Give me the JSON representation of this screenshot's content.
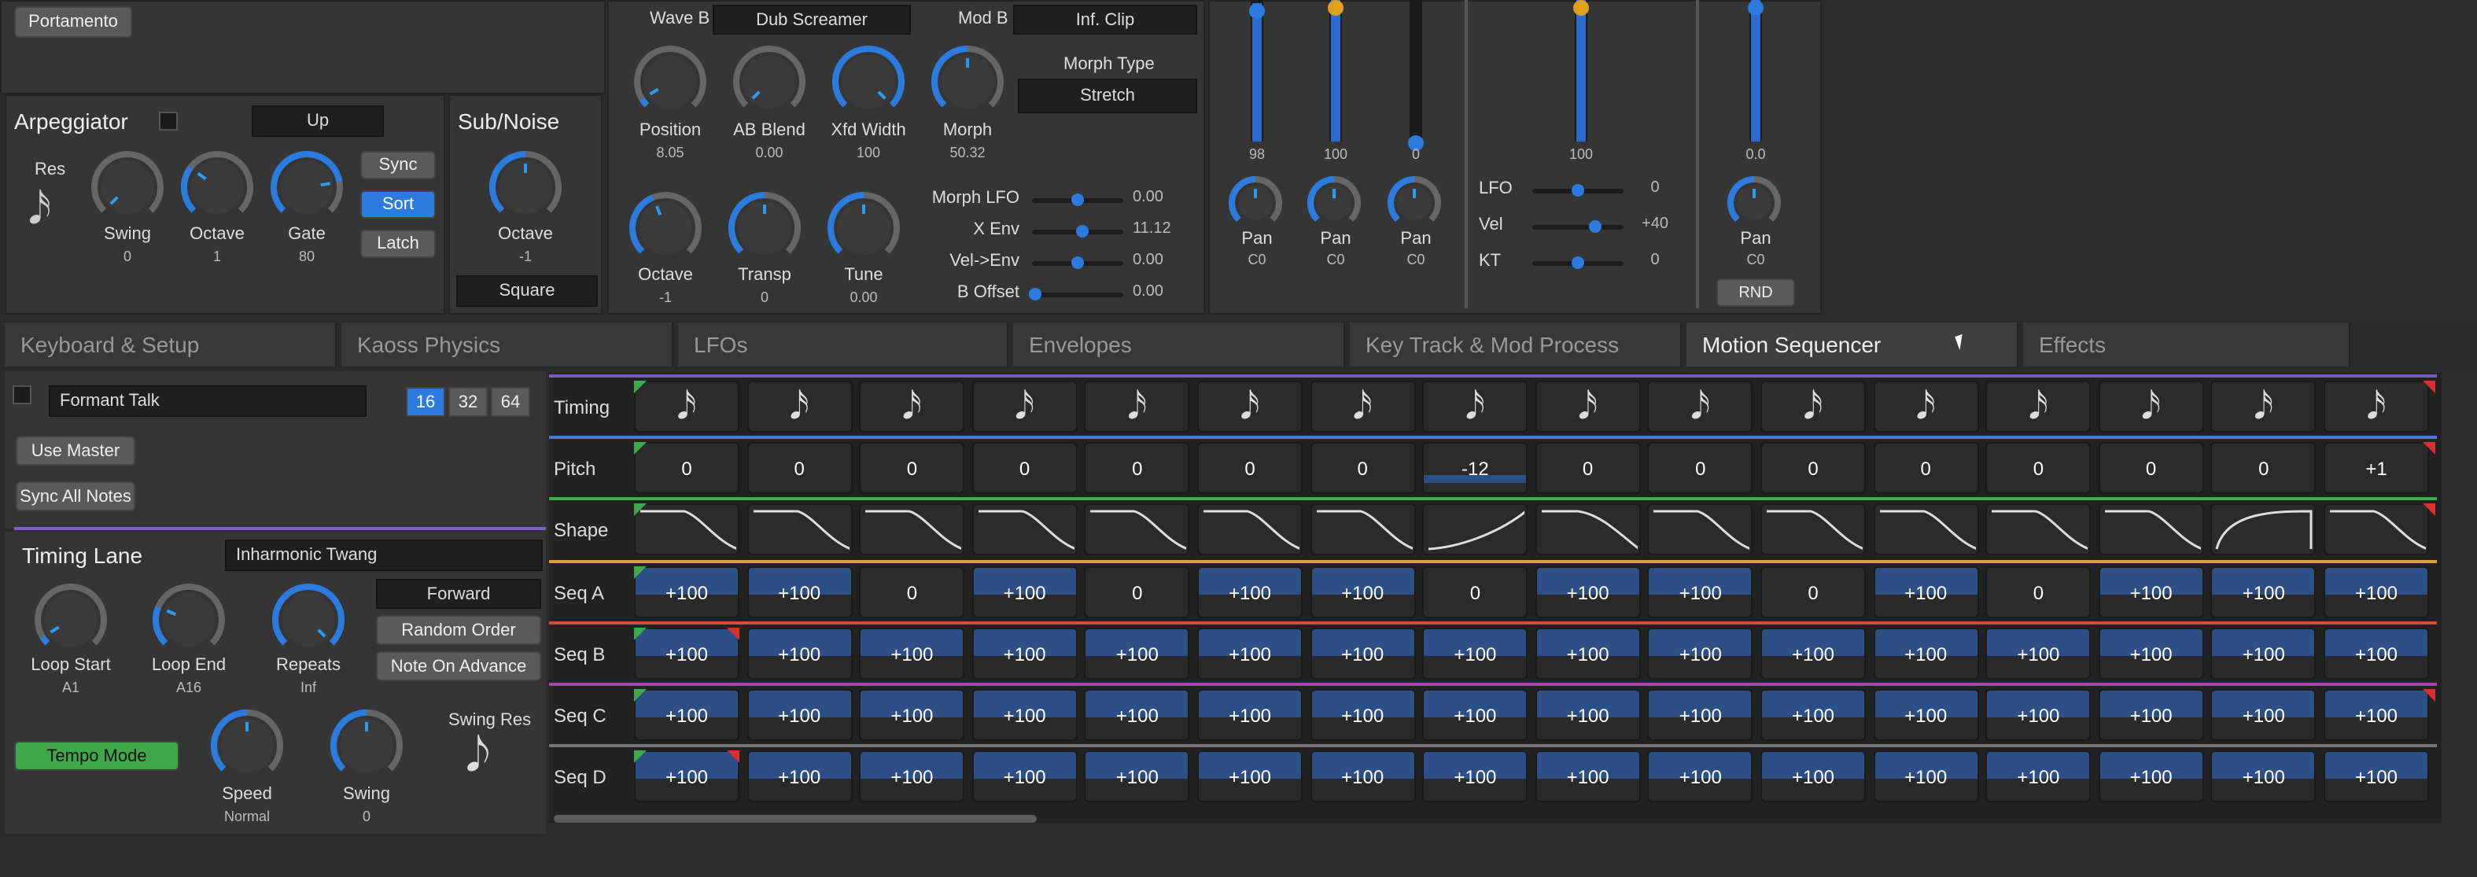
{
  "portamento": {
    "label": "Portamento"
  },
  "arp": {
    "title": "Arpeggiator",
    "mode": "Up",
    "res_label": "Res",
    "knobs": [
      {
        "label": "Swing",
        "value": "0",
        "level": 0.0
      },
      {
        "label": "Octave",
        "value": "1",
        "level": 0.3
      },
      {
        "label": "Gate",
        "value": "80",
        "level": 0.8
      }
    ],
    "buttons": [
      "Sync",
      "Sort",
      "Latch"
    ]
  },
  "subnoise": {
    "title": "Sub/Noise",
    "knob": {
      "label": "Octave",
      "value": "-1",
      "level": 0.5
    },
    "wave": "Square"
  },
  "osc": {
    "wave_b_label": "Wave B",
    "wave_b": "Dub Screamer",
    "mod_b_label": "Mod B",
    "mod_b": "Inf. Clip",
    "morph_type_label": "Morph Type",
    "morph_type": "Stretch",
    "knobs_top": [
      {
        "label": "Position",
        "value": "8.05",
        "level": 0.05
      },
      {
        "label": "AB Blend",
        "value": "0.00",
        "level": 0.0
      },
      {
        "label": "Xfd Width",
        "value": "100",
        "level": 1.0
      },
      {
        "label": "Morph",
        "value": "50.32",
        "level": 0.5
      }
    ],
    "knobs_bottom": [
      {
        "label": "Octave",
        "value": "-1",
        "level": 0.42
      },
      {
        "label": "Transp",
        "value": "0",
        "level": 0.5
      },
      {
        "label": "Tune",
        "value": "0.00",
        "level": 0.5
      }
    ],
    "sliders": [
      {
        "label": "Morph LFO",
        "value": "0.00",
        "level": 0.5
      },
      {
        "label": "X Env",
        "value": "11.12",
        "level": 0.55
      },
      {
        "label": "Vel->Env",
        "value": "0.00",
        "level": 0.5
      },
      {
        "label": "B Offset",
        "value": "0.00",
        "level": 0.0
      }
    ]
  },
  "mixer": {
    "channels": [
      {
        "value": "98",
        "level": 0.98,
        "pan": "Pan",
        "pan_val": "C0"
      },
      {
        "value": "100",
        "level": 1.0,
        "pan": "Pan",
        "pan_val": "C0"
      },
      {
        "value": "0",
        "level": 0.0,
        "pan": "Pan",
        "pan_val": "C0"
      }
    ],
    "main": {
      "value": "100",
      "level": 1.0
    },
    "mods": [
      {
        "label": "LFO",
        "value": "0",
        "level": 0.5
      },
      {
        "label": "Vel",
        "value": "+40",
        "level": 0.7
      },
      {
        "label": "KT",
        "value": "0",
        "level": 0.5
      }
    ],
    "out": {
      "value": "0.0",
      "level": 1.0,
      "pan": "Pan",
      "pan_val": "C0",
      "rnd": "RND"
    }
  },
  "tabs": [
    "Keyboard & Setup",
    "Kaoss Physics",
    "LFOs",
    "Envelopes",
    "Key Track & Mod Process",
    "Motion Sequencer",
    "Effects"
  ],
  "active_tab": 5,
  "seq": {
    "preset": "Formant Talk",
    "lengths": [
      "16",
      "32",
      "64"
    ],
    "use_master": "Use Master",
    "sync_all": "Sync All Notes",
    "lane_title": "Timing Lane",
    "lane_preset": "Inharmonic Twang",
    "directions": [
      "Forward",
      "Random Order",
      "Note On Advance"
    ],
    "knobs": [
      {
        "label": "Loop Start",
        "value": "A1",
        "level": 0.05
      },
      {
        "label": "Loop End",
        "value": "A16",
        "level": 0.25
      },
      {
        "label": "Repeats",
        "value": "Inf",
        "level": 1.0
      }
    ],
    "tempo_mode": "Tempo Mode",
    "speed": {
      "label": "Speed",
      "value": "Normal",
      "level": 0.5
    },
    "swing": {
      "label": "Swing",
      "value": "0",
      "level": 0.5
    },
    "swing_res": "Swing Res"
  },
  "lanes": [
    {
      "name": "Timing",
      "color": "#7a5cc8",
      "type": "note",
      "cells": [
        "",
        "",
        "",
        "",
        "",
        "",
        "",
        "",
        "",
        "",
        "",
        "",
        "",
        "",
        "",
        ""
      ]
    },
    {
      "name": "Pitch",
      "color": "#4a7ad8",
      "type": "value",
      "cells": [
        "0",
        "0",
        "0",
        "0",
        "0",
        "0",
        "0",
        "-12",
        "0",
        "0",
        "0",
        "0",
        "0",
        "0",
        "0",
        "+1"
      ]
    },
    {
      "name": "Shape",
      "color": "#3fa84a",
      "type": "shape",
      "cells": [
        "down",
        "down",
        "down",
        "down",
        "down",
        "down",
        "down",
        "up",
        "fall",
        "down",
        "down",
        "down",
        "down",
        "down",
        "hump",
        "down"
      ]
    },
    {
      "name": "Seq A",
      "color": "#d8a030",
      "type": "value",
      "cells": [
        "+100",
        "+100",
        "0",
        "+100",
        "0",
        "+100",
        "+100",
        "0",
        "+100",
        "+100",
        "0",
        "+100",
        "0",
        "+100",
        "+100",
        "+100"
      ]
    },
    {
      "name": "Seq B",
      "color": "#d05030",
      "type": "value",
      "cells": [
        "+100",
        "+100",
        "+100",
        "+100",
        "+100",
        "+100",
        "+100",
        "+100",
        "+100",
        "+100",
        "+100",
        "+100",
        "+100",
        "+100",
        "+100",
        "+100"
      ]
    },
    {
      "name": "Seq C",
      "color": "#b040b0",
      "type": "value",
      "cells": [
        "+100",
        "+100",
        "+100",
        "+100",
        "+100",
        "+100",
        "+100",
        "+100",
        "+100",
        "+100",
        "+100",
        "+100",
        "+100",
        "+100",
        "+100",
        "+100"
      ]
    },
    {
      "name": "Seq D",
      "color": "#777777",
      "type": "value",
      "cells": [
        "+100",
        "+100",
        "+100",
        "+100",
        "+100",
        "+100",
        "+100",
        "+100",
        "+100",
        "+100",
        "+100",
        "+100",
        "+100",
        "+100",
        "+100",
        "+100"
      ]
    }
  ]
}
